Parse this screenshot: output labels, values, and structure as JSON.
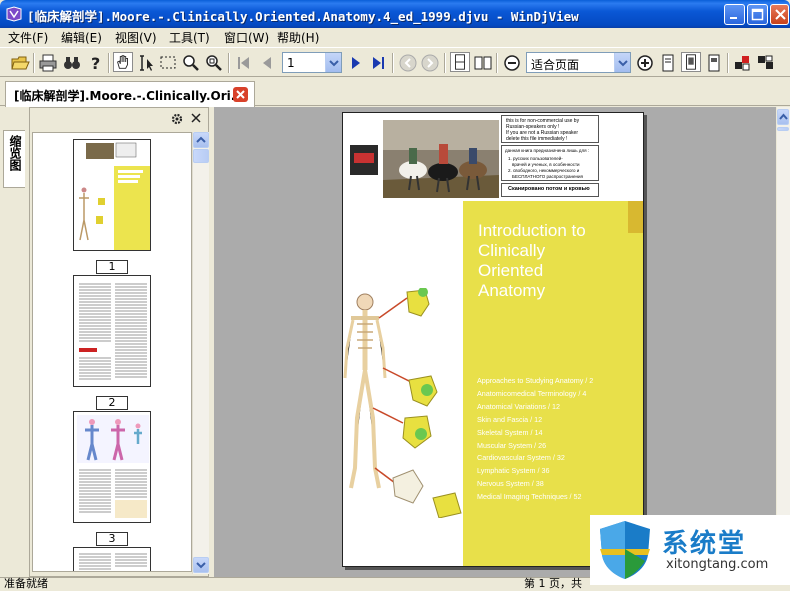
{
  "window": {
    "title": "[临床解剖学].Moore.-.Clinically.Oriented.Anatomy.4_ed_1999.djvu - WinDjView"
  },
  "menu": [
    {
      "label": "文件(F)"
    },
    {
      "label": "编辑(E)"
    },
    {
      "label": "视图(V)"
    },
    {
      "label": "工具(T)"
    },
    {
      "label": "窗口(W)"
    },
    {
      "label": "帮助(H)"
    }
  ],
  "toolbar": {
    "page_number": "1",
    "zoom": "适合页面"
  },
  "tab": {
    "label": "[临床解剖学].Moore.-.Clinically.Ori..."
  },
  "sidebar": {
    "tab_label": "缩览图",
    "thumbnails": [
      {
        "page": "1"
      },
      {
        "page": "2"
      },
      {
        "page": "3"
      }
    ]
  },
  "document_page": {
    "notice_lines": [
      "this is for non-commercial use by",
      "Russian-speakers only !",
      "If you are not a Russian speaker",
      "delete this file immediately !"
    ],
    "notice_ru_head": "данная книга предназначена лишь для :",
    "notice_ru_items": [
      "1. русских пользователей-",
      "врачей и ученых, в особенности",
      "2. свободного, некоммерческого и",
      "БЕСПЛАТНОГО распространения"
    ],
    "scan_line": "Сканировано потом и кровью",
    "title_lines": [
      "Introduction to",
      "Clinically",
      "Oriented",
      "Anatomy"
    ],
    "contents": [
      "Approaches to Studying Anatomy / 2",
      "Anatomicomedical Terminology / 4",
      "Anatomical Variations / 12",
      "Skin and Fascia / 12",
      "Skeletal System / 14",
      "Muscular System / 26",
      "Cardiovascular System / 32",
      "Lymphatic System / 36",
      "Nervous System / 38",
      "Medical Imaging Techniques / 52"
    ]
  },
  "status": {
    "left": "准备就绪",
    "right": "第 1 页，共"
  },
  "watermark": {
    "cn": "系统堂",
    "en": "xitongtang.com"
  },
  "colors": {
    "titlebar": "#0a58d6",
    "page_yellow": "#e8e04a",
    "accent_red": "#d8412a"
  }
}
